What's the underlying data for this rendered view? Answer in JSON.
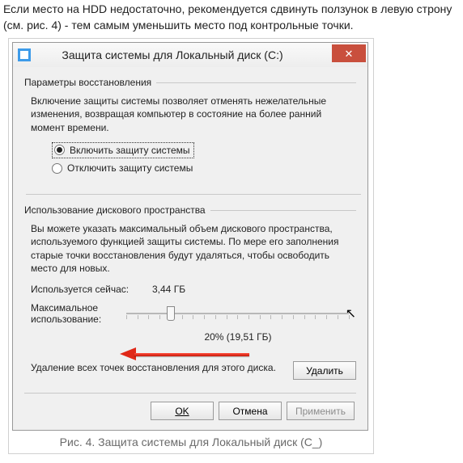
{
  "intro_text": "Если место на HDD недостаточно, рекомендуется сдвинуть ползунок в левую строну (см. рис. 4) - тем самым уменьшить место под контрольные точки.",
  "dialog": {
    "title": "Защита системы для Локальный диск (C:)",
    "group1": {
      "header": "Параметры восстановления",
      "desc": "Включение защиты системы позволяет отменять нежелательные изменения, возвращая компьютер в состояние на более ранний момент времени.",
      "opt_on": "Включить защиту системы",
      "opt_off": "Отключить защиту системы"
    },
    "group2": {
      "header": "Использование дискового пространства",
      "desc": "Вы можете указать максимальный объем дискового пространства, используемого функцией защиты системы. По мере его заполнения старые точки восстановления будут удаляться, чтобы освободить место для новых.",
      "current_label": "Используется сейчас:",
      "current_value": "3,44 ГБ",
      "max_label": "Максимальное использование:",
      "slider_value": "20% (19,51 ГБ)",
      "slider_percent": 20,
      "delete_text": "Удаление всех точек восстановления для этого диска.",
      "delete_btn": "Удалить"
    },
    "footer": {
      "ok": "OK",
      "cancel": "Отмена",
      "apply": "Применить"
    }
  },
  "caption": "Рис. 4. Защита системы для Локальный диск (C_)"
}
